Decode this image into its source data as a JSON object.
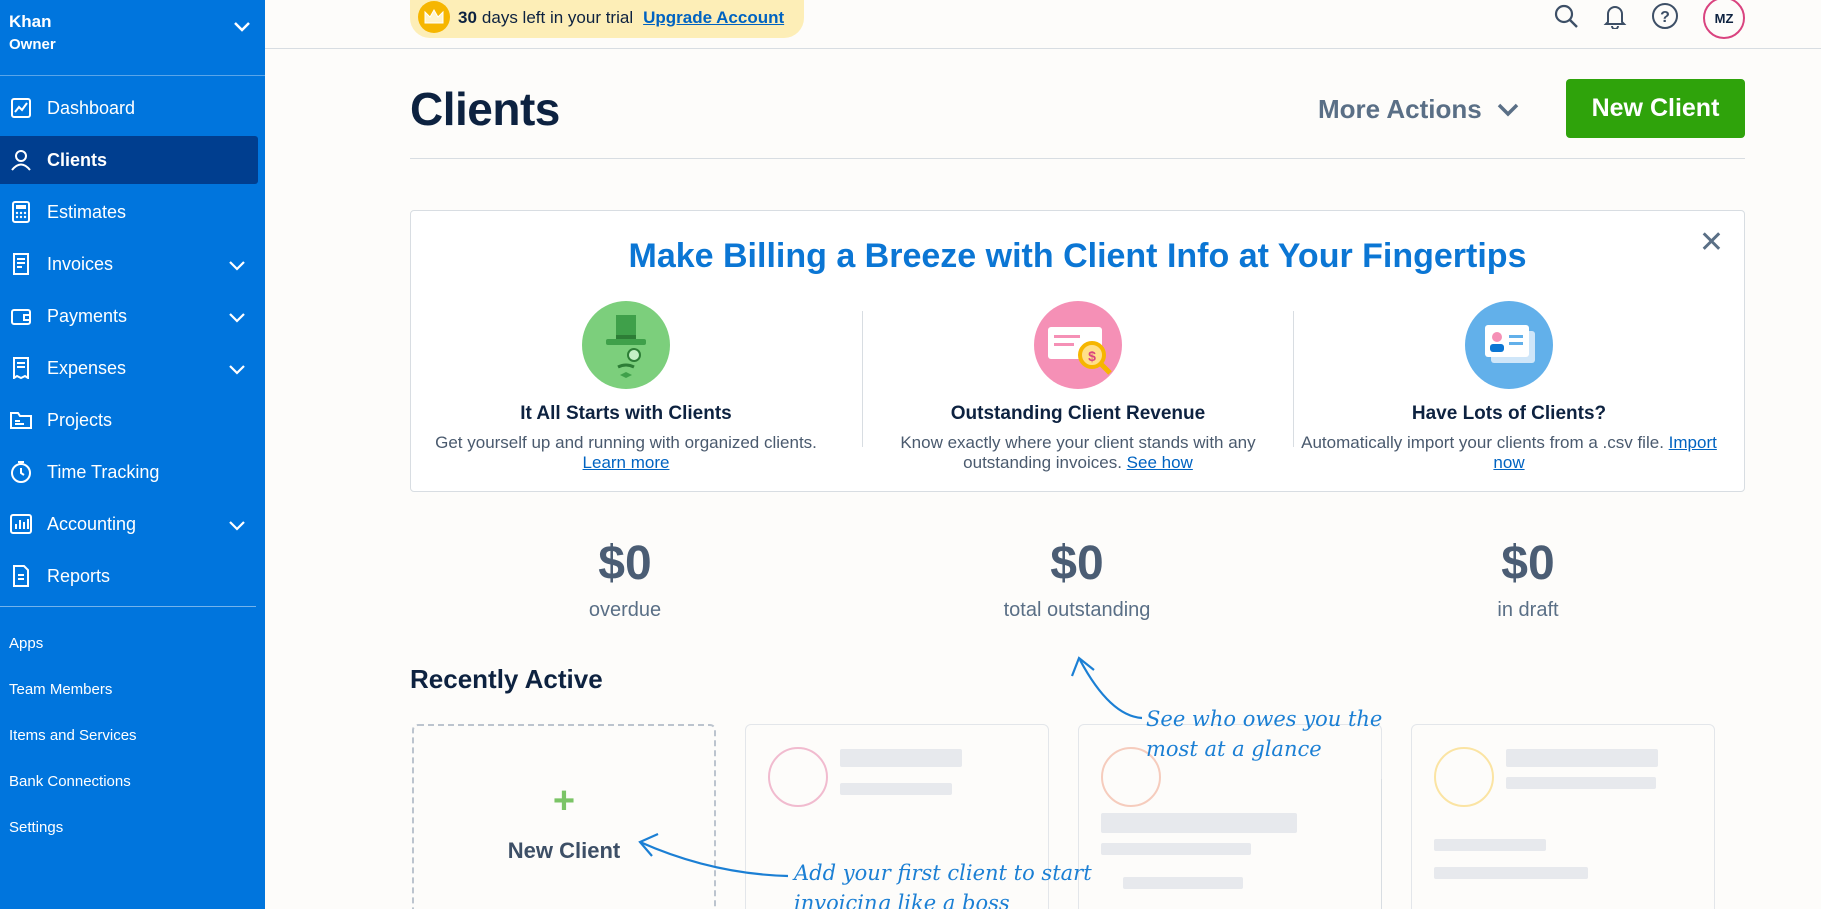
{
  "account": {
    "name": "Khan",
    "role": "Owner"
  },
  "sidebar": {
    "items": [
      {
        "label": "Dashboard",
        "icon": "chart-icon",
        "expandable": false,
        "active": false
      },
      {
        "label": "Clients",
        "icon": "user-icon",
        "expandable": false,
        "active": true
      },
      {
        "label": "Estimates",
        "icon": "calculator-icon",
        "expandable": false,
        "active": false
      },
      {
        "label": "Invoices",
        "icon": "invoice-icon",
        "expandable": true,
        "active": false
      },
      {
        "label": "Payments",
        "icon": "wallet-icon",
        "expandable": true,
        "active": false
      },
      {
        "label": "Expenses",
        "icon": "receipt-icon",
        "expandable": true,
        "active": false
      },
      {
        "label": "Projects",
        "icon": "folder-icon",
        "expandable": false,
        "active": false
      },
      {
        "label": "Time Tracking",
        "icon": "clock-icon",
        "expandable": false,
        "active": false
      },
      {
        "label": "Accounting",
        "icon": "bar-chart-icon",
        "expandable": true,
        "active": false
      },
      {
        "label": "Reports",
        "icon": "report-icon",
        "expandable": false,
        "active": false
      }
    ],
    "secondary": [
      "Apps",
      "Team Members",
      "Items and Services",
      "Bank Connections",
      "Settings"
    ]
  },
  "topbar": {
    "trial_days": "30",
    "trial_text": "days left in your trial",
    "upgrade_label": "Upgrade Account",
    "avatar_initials": "MZ"
  },
  "header": {
    "title": "Clients",
    "more_actions": "More Actions",
    "new_client": "New Client"
  },
  "promo": {
    "title": "Make Billing a Breeze with Client Info at Your Fingertips",
    "columns": [
      {
        "heading": "It All Starts with Clients",
        "text": "Get yourself up and running with organized clients.",
        "link": "Learn more",
        "color": "#7ccf7c"
      },
      {
        "heading": "Outstanding Client Revenue",
        "text": "Know exactly where your client stands with any outstanding invoices.",
        "link": "See how",
        "color": "#f590b6"
      },
      {
        "heading": "Have Lots of Clients?",
        "text": "Automatically import your clients from a .csv file.",
        "link": "Import now",
        "color": "#62b0ea"
      }
    ]
  },
  "stats": [
    {
      "amount": "$0",
      "label": "overdue"
    },
    {
      "amount": "$0",
      "label": "total outstanding"
    },
    {
      "amount": "$0",
      "label": "in draft"
    }
  ],
  "recent": {
    "title": "Recently Active",
    "new_client_card": "New Client"
  },
  "annotations": {
    "glance": [
      "See who owes you the",
      "most at a glance"
    ],
    "first_client": [
      "Add your first client to start",
      "invoicing like a boss"
    ]
  },
  "colors": {
    "sidebar": "#0075dd",
    "active": "#003e8f",
    "primary_button": "#2fa30b",
    "accent": "#0b76d4"
  }
}
